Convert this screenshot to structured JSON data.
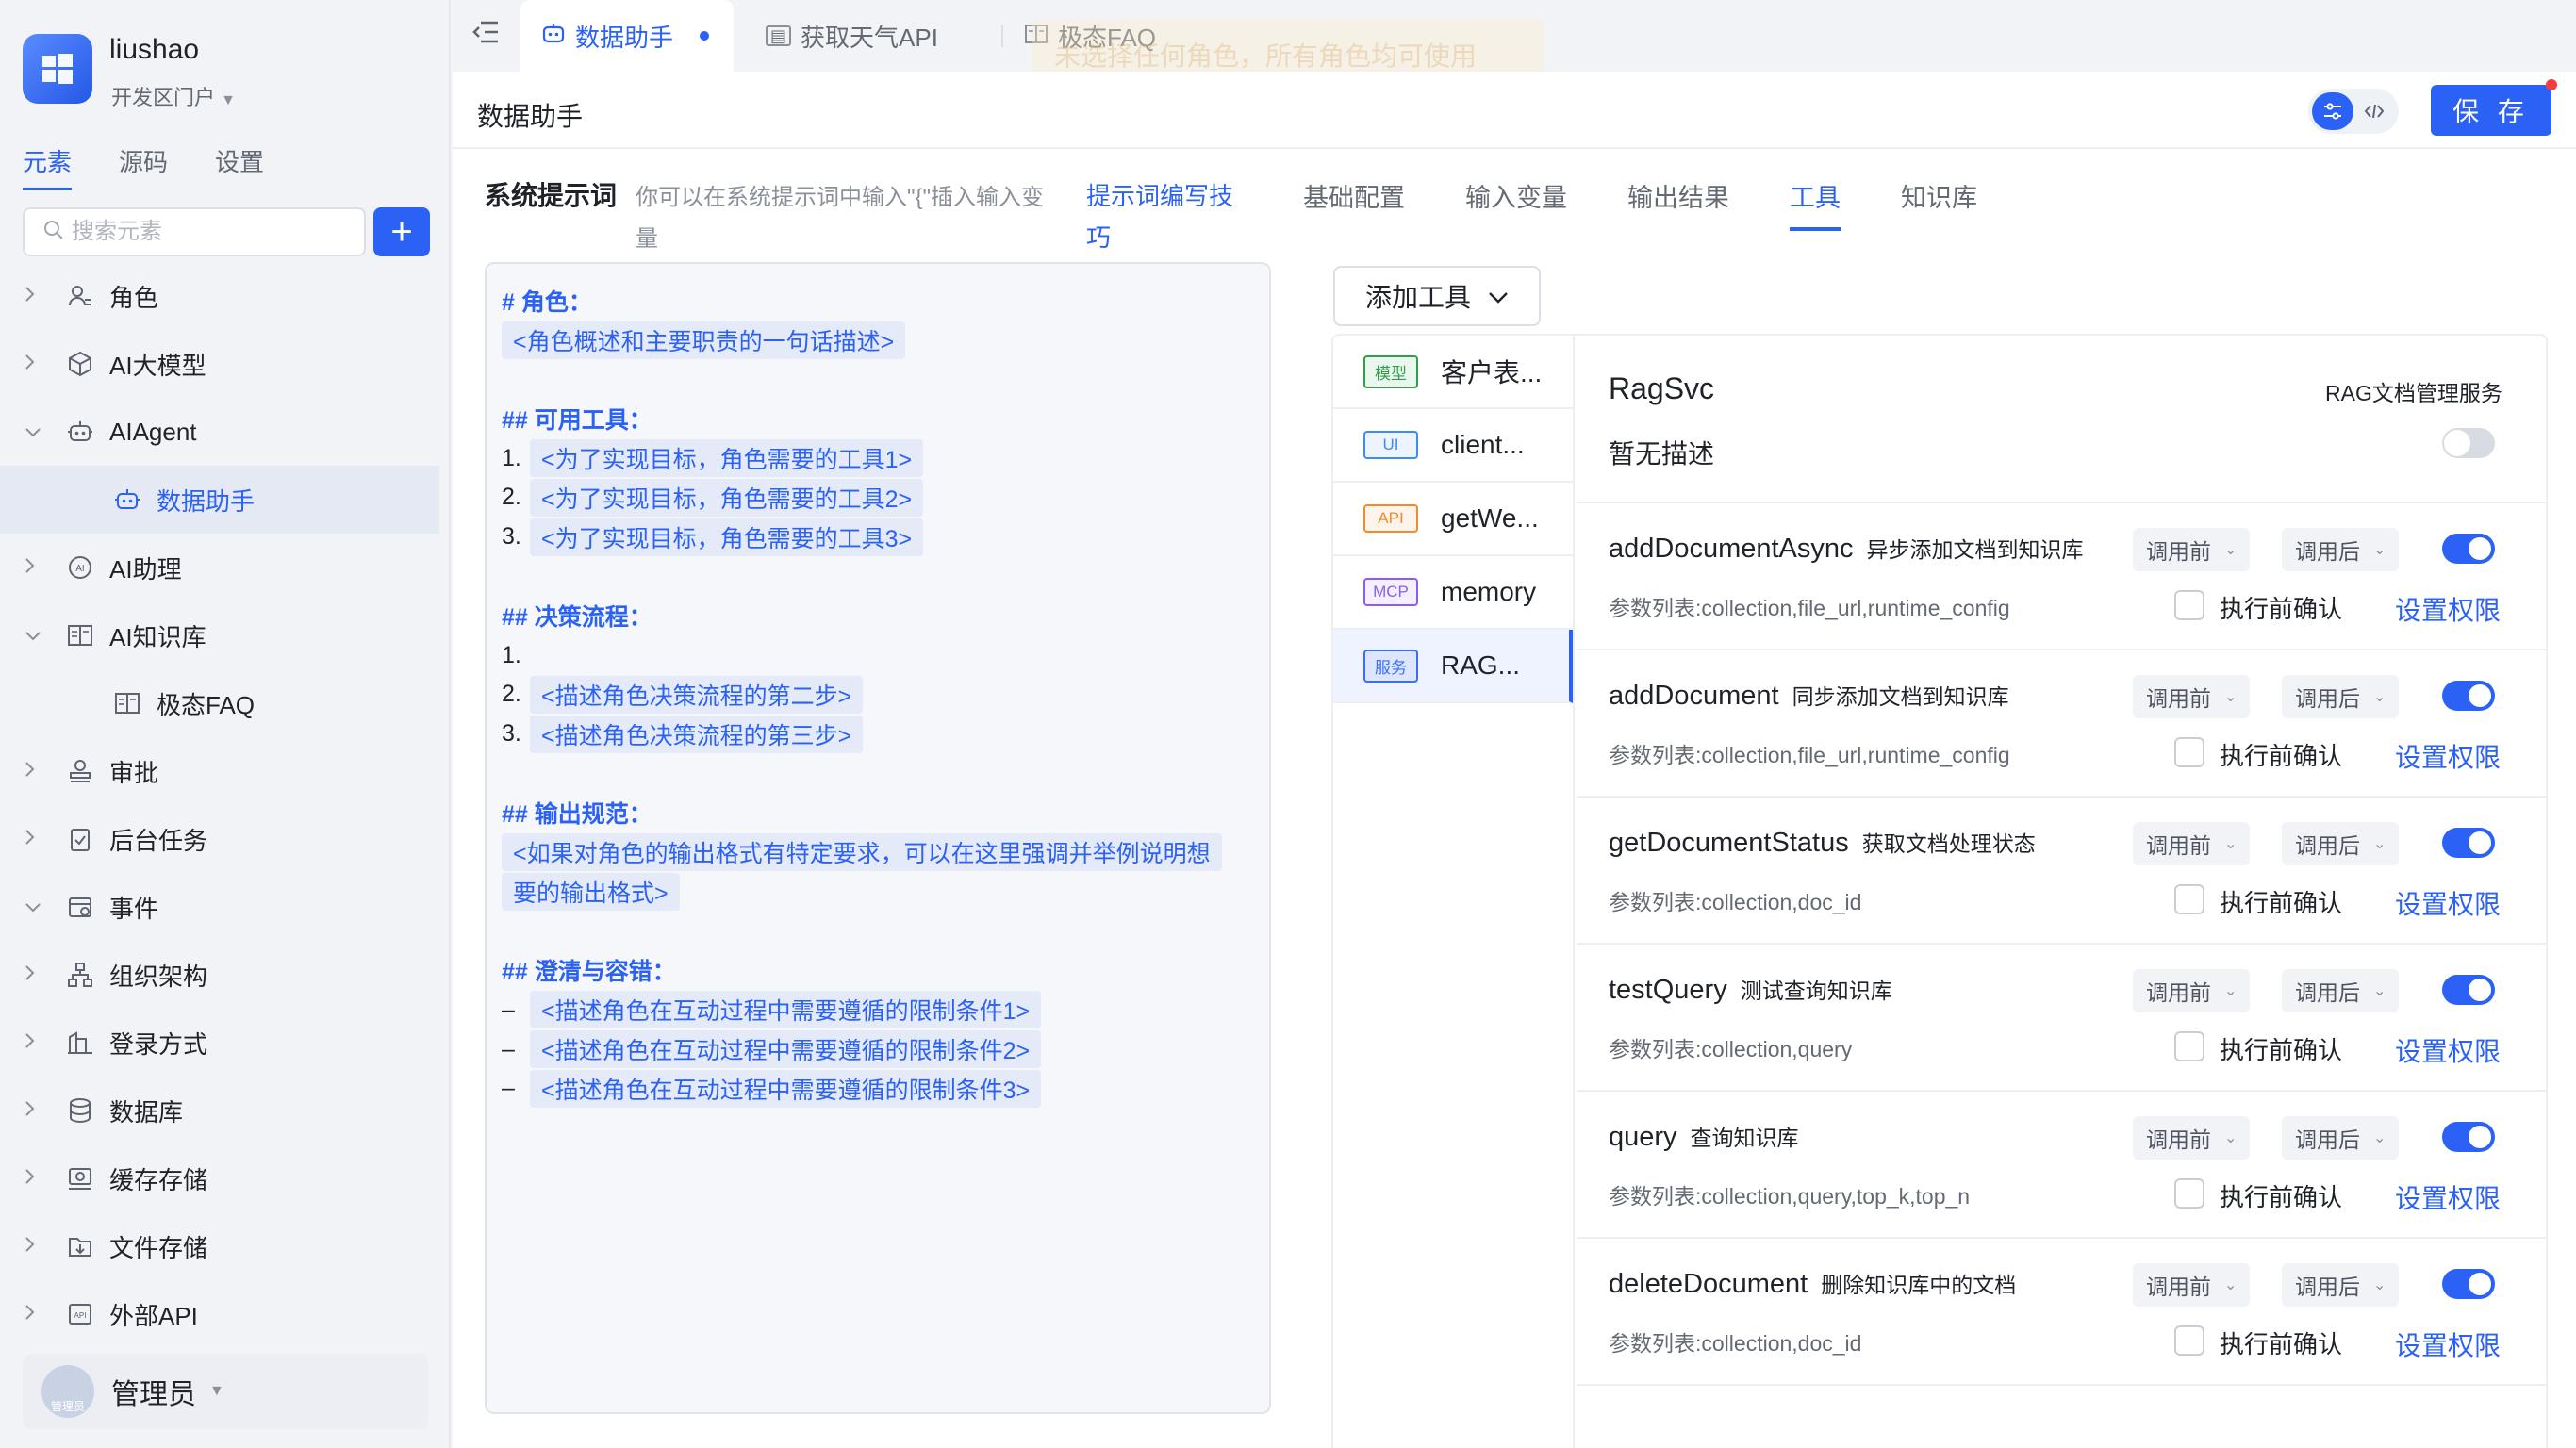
{
  "sidebar": {
    "user": "liushao",
    "portal": "开发区门户",
    "tabs": [
      "元素",
      "源码",
      "设置"
    ],
    "search_placeholder": "搜索元素",
    "tree": [
      {
        "label": "角色",
        "icon": "role-icon",
        "expand": "collapsed"
      },
      {
        "label": "AI大模型",
        "icon": "model-icon",
        "expand": "collapsed"
      },
      {
        "label": "AIAgent",
        "icon": "robot-icon",
        "expand": "expanded"
      },
      {
        "label": "数据助手",
        "icon": "robot-icon",
        "child": true,
        "selected": true
      },
      {
        "label": "AI助理",
        "icon": "ai-assistant-icon",
        "expand": "collapsed"
      },
      {
        "label": "AI知识库",
        "icon": "book-icon",
        "expand": "expanded"
      },
      {
        "label": "极态FAQ",
        "icon": "book-icon",
        "child": true
      },
      {
        "label": "审批",
        "icon": "approval-icon",
        "expand": "collapsed"
      },
      {
        "label": "后台任务",
        "icon": "task-icon",
        "expand": "collapsed"
      },
      {
        "label": "事件",
        "icon": "event-icon",
        "expand": "expanded"
      },
      {
        "label": "组织架构",
        "icon": "org-icon",
        "expand": "collapsed"
      },
      {
        "label": "登录方式",
        "icon": "login-icon",
        "expand": "collapsed"
      },
      {
        "label": "数据库",
        "icon": "database-icon",
        "expand": "collapsed"
      },
      {
        "label": "缓存存储",
        "icon": "cache-icon",
        "expand": "collapsed"
      },
      {
        "label": "文件存储",
        "icon": "file-storage-icon",
        "expand": "collapsed"
      },
      {
        "label": "外部API",
        "icon": "api-icon",
        "expand": "collapsed"
      }
    ],
    "admin": {
      "name": "管理员",
      "avatar_text": "管理员"
    }
  },
  "topbar": {
    "tabs": [
      {
        "label": "数据助手",
        "icon": "robot-icon",
        "active": true
      },
      {
        "label": "获取天气API",
        "icon": "api-icon"
      },
      {
        "label": "极态FAQ",
        "icon": "book-icon"
      }
    ],
    "toast": "未选择任何角色，所有角色均可使用"
  },
  "main": {
    "title": "数据助手",
    "save_label": "保 存",
    "prompt": {
      "label": "系统提示词",
      "hint": "你可以在系统提示词中输入\"{\"插入输入变量",
      "link": "提示词编写技巧",
      "lines": [
        {
          "h": "# 角色："
        },
        {
          "p": "<角色概述和主要职责的一句话描述>"
        },
        {},
        {
          "h": "## 可用工具："
        },
        {
          "n": "1.",
          "p": "<为了实现目标，角色需要的工具1>"
        },
        {
          "n": "2.",
          "p": "<为了实现目标，角色需要的工具2>"
        },
        {
          "n": "3.",
          "p": "<为了实现目标，角色需要的工具3>"
        },
        {},
        {
          "h": "## 决策流程："
        },
        {
          "n": "1."
        },
        {
          "n": "2.",
          "p": "<描述角色决策流程的第二步>"
        },
        {
          "n": "3.",
          "p": "<描述角色决策流程的第三步>"
        },
        {},
        {
          "h": "## 输出规范："
        },
        {
          "p": "<如果对角色的输出格式有特定要求，可以在这里强调并举例说明想"
        },
        {
          "p": "要的输出格式>"
        },
        {},
        {
          "h": "## 澄清与容错："
        },
        {
          "n": "–",
          "p": "<描述角色在互动过程中需要遵循的限制条件1>"
        },
        {
          "n": "–",
          "p": "<描述角色在互动过程中需要遵循的限制条件2>"
        },
        {
          "n": "–",
          "p": "<描述角色在互动过程中需要遵循的限制条件3>"
        }
      ]
    },
    "config_tabs": [
      {
        "label": "基础配置"
      },
      {
        "label": "输入变量"
      },
      {
        "label": "输出结果"
      },
      {
        "label": "工具",
        "active": true
      },
      {
        "label": "知识库"
      }
    ],
    "add_tool_label": "添加工具",
    "tool_list": [
      {
        "tag": "模型",
        "name": "客户表...",
        "color": "#2ea04a"
      },
      {
        "tag": "UI",
        "name": "client...",
        "color": "#3b8cf5"
      },
      {
        "tag": "API",
        "name": "getWe...",
        "color": "#f08c2b"
      },
      {
        "tag": "MCP",
        "name": "memory",
        "color": "#8b5cf6"
      },
      {
        "tag": "服务",
        "name": "RAG...",
        "color": "#3b6df5",
        "selected": true
      }
    ],
    "service": {
      "name": "RagSvc",
      "category": "RAG文档管理服务",
      "desc": "暂无描述",
      "enabled": false
    },
    "methods": [
      {
        "name": "addDocumentAsync",
        "cn": "异步添加文档到知识库",
        "params": "参数列表:collection,file_url,runtime_config",
        "before": "调用前",
        "after": "调用后",
        "confirm": "执行前确认",
        "perm": "设置权限",
        "enabled": true
      },
      {
        "name": "addDocument",
        "cn": "同步添加文档到知识库",
        "params": "参数列表:collection,file_url,runtime_config",
        "before": "调用前",
        "after": "调用后",
        "confirm": "执行前确认",
        "perm": "设置权限",
        "enabled": true
      },
      {
        "name": "getDocumentStatus",
        "cn": "获取文档处理状态",
        "params": "参数列表:collection,doc_id",
        "before": "调用前",
        "after": "调用后",
        "confirm": "执行前确认",
        "perm": "设置权限",
        "enabled": true
      },
      {
        "name": "testQuery",
        "cn": "测试查询知识库",
        "params": "参数列表:collection,query",
        "before": "调用前",
        "after": "调用后",
        "confirm": "执行前确认",
        "perm": "设置权限",
        "enabled": true
      },
      {
        "name": "query",
        "cn": "查询知识库",
        "params": "参数列表:collection,query,top_k,top_n",
        "before": "调用前",
        "after": "调用后",
        "confirm": "执行前确认",
        "perm": "设置权限",
        "enabled": true
      },
      {
        "name": "deleteDocument",
        "cn": "删除知识库中的文档",
        "params": "参数列表:collection,doc_id",
        "before": "调用前",
        "after": "调用后",
        "confirm": "执行前确认",
        "perm": "设置权限",
        "enabled": true
      }
    ]
  },
  "colors": {
    "accent": "#2b62f5",
    "sidebar_bg": "#f2f3f6"
  }
}
